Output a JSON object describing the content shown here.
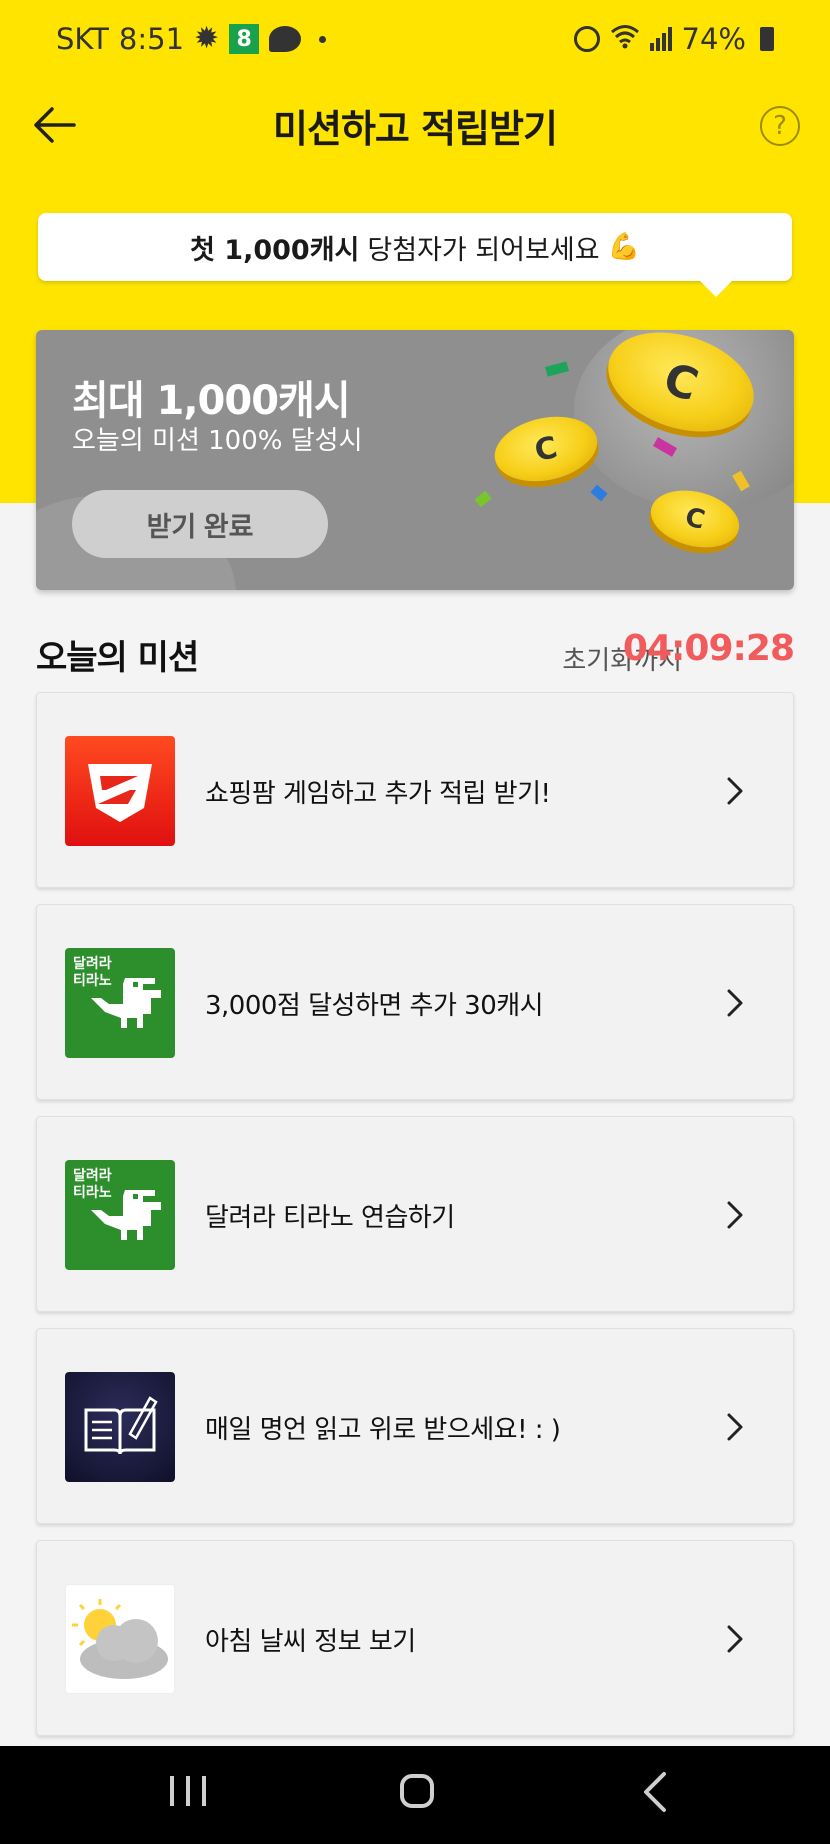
{
  "status_bar": {
    "carrier": "SKT",
    "time": "8:51",
    "app_badge": "8",
    "battery": "74%"
  },
  "header": {
    "title": "미션하고 적립받기",
    "help": "?"
  },
  "tooltip": {
    "bold": "첫 1,000캐시",
    "text": "당첨자가 되어보세요",
    "emoji": "💪"
  },
  "banner": {
    "title": "최대 1,000캐시",
    "subtitle": "오늘의 미션 100% 달성시",
    "button": "받기 완료",
    "coin_symbol": "C"
  },
  "missions_section": {
    "title": "오늘의 미션",
    "reset_label": "초기화까지",
    "reset_time": "04:09:28"
  },
  "missions": [
    {
      "label": "쇼핑팜 게임하고 추가 적립 받기!",
      "icon": "shopping-farm-icon"
    },
    {
      "label": "3,000점 달성하면 추가 30캐시",
      "icon": "dino-run-icon",
      "icon_text_1": "달려라",
      "icon_text_2": "티라노"
    },
    {
      "label": "달려라 티라노 연습하기",
      "icon": "dino-run-icon",
      "icon_text_1": "달려라",
      "icon_text_2": "티라노"
    },
    {
      "label": "매일 명언 읽고 위로 받으세요! : )",
      "icon": "book-pen-icon"
    },
    {
      "label": "아침 날씨 정보 보기",
      "icon": "weather-cloud-sun-icon"
    }
  ],
  "colors": {
    "brand_yellow": "#ffe400",
    "timer_red": "#f25b5b",
    "banner_gray": "#8f8f8f"
  }
}
